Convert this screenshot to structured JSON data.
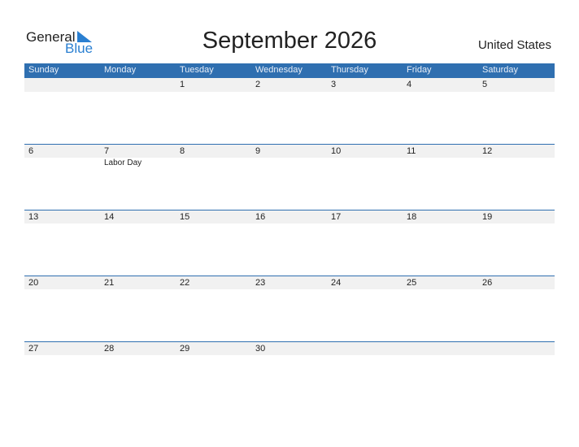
{
  "logo": {
    "word1": "General",
    "word2": "Blue",
    "accent_color": "#2a7fd1"
  },
  "title": "September 2026",
  "country": "United States",
  "header_color": "#2f6fb0",
  "weekdays": [
    "Sunday",
    "Monday",
    "Tuesday",
    "Wednesday",
    "Thursday",
    "Friday",
    "Saturday"
  ],
  "weeks": [
    [
      {
        "day": ""
      },
      {
        "day": ""
      },
      {
        "day": "1"
      },
      {
        "day": "2"
      },
      {
        "day": "3"
      },
      {
        "day": "4"
      },
      {
        "day": "5"
      }
    ],
    [
      {
        "day": "6"
      },
      {
        "day": "7",
        "event": "Labor Day"
      },
      {
        "day": "8"
      },
      {
        "day": "9"
      },
      {
        "day": "10"
      },
      {
        "day": "11"
      },
      {
        "day": "12"
      }
    ],
    [
      {
        "day": "13"
      },
      {
        "day": "14"
      },
      {
        "day": "15"
      },
      {
        "day": "16"
      },
      {
        "day": "17"
      },
      {
        "day": "18"
      },
      {
        "day": "19"
      }
    ],
    [
      {
        "day": "20"
      },
      {
        "day": "21"
      },
      {
        "day": "22"
      },
      {
        "day": "23"
      },
      {
        "day": "24"
      },
      {
        "day": "25"
      },
      {
        "day": "26"
      }
    ],
    [
      {
        "day": "27"
      },
      {
        "day": "28"
      },
      {
        "day": "29"
      },
      {
        "day": "30"
      },
      {
        "day": ""
      },
      {
        "day": ""
      },
      {
        "day": ""
      }
    ]
  ]
}
